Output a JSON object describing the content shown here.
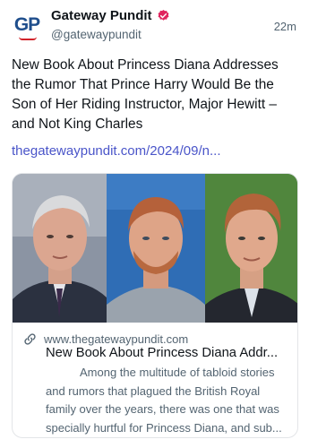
{
  "author": {
    "display_name": "Gateway Pundit",
    "handle": "@gatewaypundit",
    "avatar_text": "GP",
    "verified_icon": "verified-badge-icon"
  },
  "post": {
    "timestamp": "22m",
    "text": "New Book About Princess Diana Addresses the Rumor That Prince Harry Would Be the Son of Her Riding Instructor, Major Hewitt – and Not King Charles",
    "link_text": "thegatewaypundit.com/2024/09/n..."
  },
  "card": {
    "domain": "www.thegatewaypundit.com",
    "title": "New Book About Princess Diana Addr...",
    "description": "Among the multitude of tabloid stories and rumors that plagued the British Royal family over the years, there was one that was specially hurtful for Princess Diana, and sub...",
    "link_icon": "link-icon"
  },
  "colors": {
    "brand_blue": "#1f4e8c",
    "brand_red": "#d2232a",
    "verified": "#e0245e",
    "link": "#4a55c9",
    "secondary_text": "#536471"
  }
}
